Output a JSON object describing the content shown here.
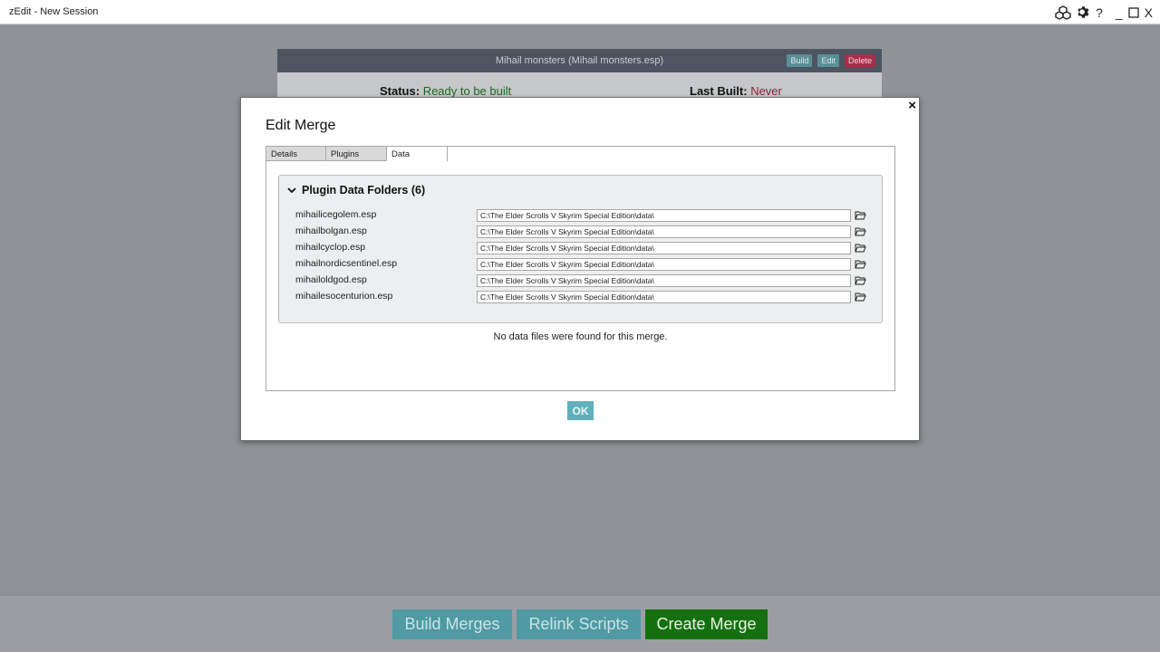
{
  "window": {
    "title": "zEdit - New Session",
    "controls": {
      "help": "?",
      "minimize": "_",
      "close": "X"
    }
  },
  "merge_card": {
    "name": "Mihail monsters (Mihail monsters.esp)",
    "buttons": {
      "build": "Build",
      "edit": "Edit",
      "delete": "Delete"
    },
    "status_label": "Status:",
    "status_value": "Ready to be built",
    "last_built_label": "Last Built:",
    "last_built_value": "Never"
  },
  "modal": {
    "title": "Edit Merge",
    "close_glyph": "×",
    "tabs": [
      {
        "label": "Details"
      },
      {
        "label": "Plugins"
      },
      {
        "label": "Data"
      }
    ],
    "active_tab": "Data",
    "folders_header": "Plugin Data Folders (6)",
    "folders": [
      {
        "plugin": "mihailicegolem.esp",
        "path": "C:\\The Elder Scrolls V Skyrim Special Edition\\data\\"
      },
      {
        "plugin": "mihailbolgan.esp",
        "path": "C:\\The Elder Scrolls V Skyrim Special Edition\\data\\"
      },
      {
        "plugin": "mihailcyclop.esp",
        "path": "C:\\The Elder Scrolls V Skyrim Special Edition\\data\\"
      },
      {
        "plugin": "mihailnordicsentinel.esp",
        "path": "C:\\The Elder Scrolls V Skyrim Special Edition\\data\\"
      },
      {
        "plugin": "mihailoldgod.esp",
        "path": "C:\\The Elder Scrolls V Skyrim Special Edition\\data\\"
      },
      {
        "plugin": "mihailesocenturion.esp",
        "path": "C:\\The Elder Scrolls V Skyrim Special Edition\\data\\"
      }
    ],
    "no_data_message": "No data files were found for this merge.",
    "ok_label": "OK"
  },
  "bottom_bar": {
    "build_merges": "Build Merges",
    "relink_scripts": "Relink Scripts",
    "create_merge": "Create Merge"
  },
  "colors": {
    "teal": "#4f9aa3",
    "green": "#14700f",
    "delete_red": "#a5304a",
    "status_green": "#1c6a1c",
    "never_red": "#8e2136"
  },
  "icons": [
    "dice-icon",
    "gear-icon",
    "help-icon",
    "minimize-icon",
    "maximize-icon",
    "close-icon",
    "chevron-down-icon",
    "folder-open-icon"
  ]
}
